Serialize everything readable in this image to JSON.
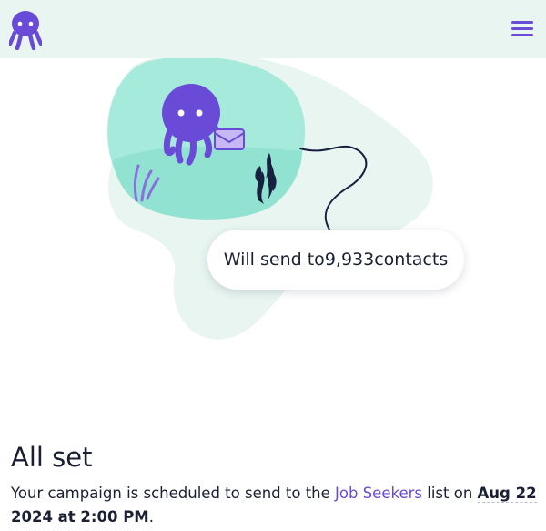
{
  "header": {
    "logo_icon": "octopus-logo-icon",
    "menu_icon": "hamburger-menu-icon"
  },
  "illustration": {
    "send_pill_prefix": "Will send to ",
    "contact_count": "9,933",
    "send_pill_suffix": " contacts"
  },
  "status": {
    "title": "All set",
    "text_before_list": "Your campaign is scheduled to send to the ",
    "list_name": "Job Seekers",
    "text_after_list": " list on ",
    "send_datetime": "Aug 22 2024 at 2:00 PM",
    "text_end": "."
  },
  "colors": {
    "brand_purple": "#6a4bd8",
    "header_background": "#e9f5f1",
    "bubble_mint": "#a6eadb",
    "blob_pale": "#e8f5f1"
  }
}
